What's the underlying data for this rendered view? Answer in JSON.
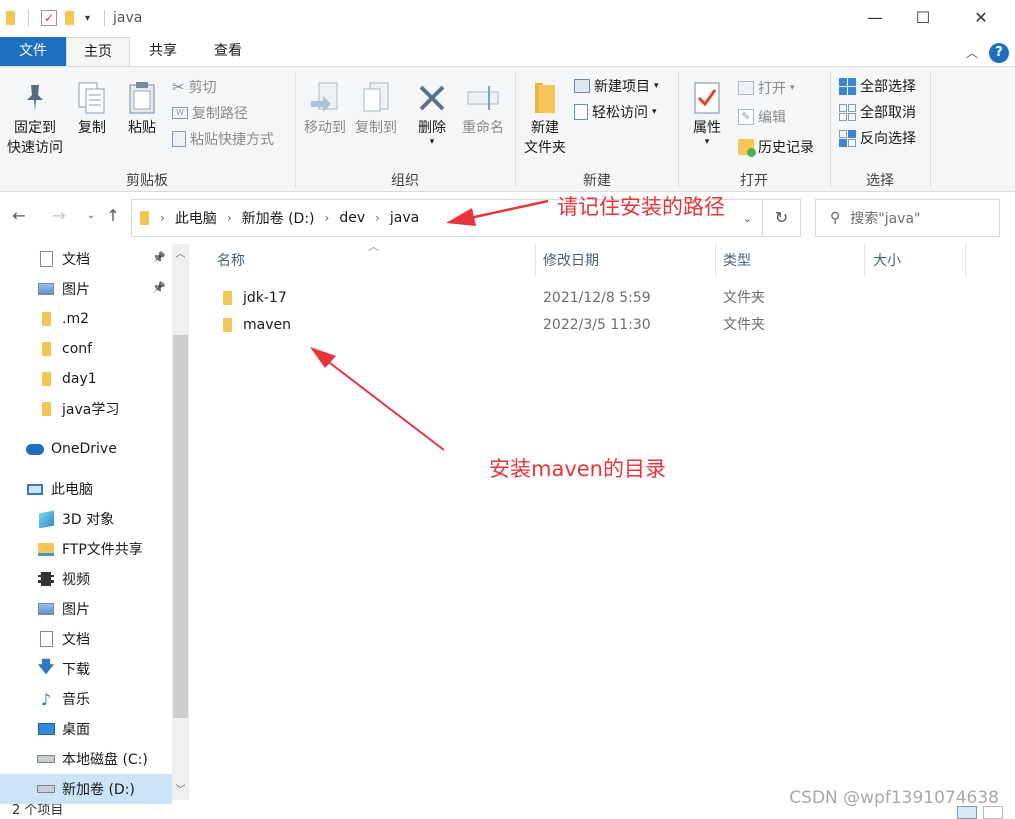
{
  "window": {
    "title": "java",
    "minimize": "—",
    "maximize": "☐",
    "close": "✕"
  },
  "ribbon_tabs": [
    "文件",
    "主页",
    "共享",
    "查看"
  ],
  "ribbon": {
    "clipboard": {
      "label": "剪贴板",
      "pin": "固定到\n快速访问",
      "pin_line1": "固定到",
      "pin_line2": "快速访问",
      "copy": "复制",
      "paste": "粘贴",
      "cut": "剪切",
      "copy_path": "复制路径",
      "paste_shortcut": "粘贴快捷方式"
    },
    "organize": {
      "label": "组织",
      "move_to": "移动到",
      "copy_to": "复制到",
      "delete": "删除",
      "rename": "重命名"
    },
    "new": {
      "label": "新建",
      "new_folder_line1": "新建",
      "new_folder_line2": "文件夹",
      "new_item": "新建项目",
      "easy_access": "轻松访问"
    },
    "open": {
      "label": "打开",
      "properties": "属性",
      "open": "打开",
      "edit": "编辑",
      "history": "历史记录"
    },
    "select": {
      "label": "选择",
      "select_all": "全部选择",
      "select_none": "全部取消",
      "invert": "反向选择"
    }
  },
  "address": {
    "crumbs": [
      "此电脑",
      "新加卷 (D:)",
      "dev",
      "java"
    ],
    "search_placeholder": "搜索\"java\""
  },
  "nav": [
    {
      "label": "文档",
      "icon": "document-icon",
      "pinned": true
    },
    {
      "label": "图片",
      "icon": "pictures-icon",
      "pinned": true
    },
    {
      "label": ".m2",
      "icon": "folder-icon"
    },
    {
      "label": "conf",
      "icon": "folder-icon"
    },
    {
      "label": "day1",
      "icon": "folder-icon"
    },
    {
      "label": "java学习",
      "icon": "folder-icon"
    },
    {
      "label": "OneDrive",
      "icon": "cloud-icon"
    },
    {
      "label": "此电脑",
      "icon": "computer-icon"
    },
    {
      "label": "3D 对象",
      "icon": "3d-objects-icon"
    },
    {
      "label": "FTP文件共享",
      "icon": "ftp-share-icon"
    },
    {
      "label": "视频",
      "icon": "video-icon"
    },
    {
      "label": "图片",
      "icon": "pictures-icon"
    },
    {
      "label": "文档",
      "icon": "document-icon"
    },
    {
      "label": "下载",
      "icon": "download-icon"
    },
    {
      "label": "音乐",
      "icon": "music-icon"
    },
    {
      "label": "桌面",
      "icon": "desktop-icon"
    },
    {
      "label": "本地磁盘 (C:)",
      "icon": "drive-icon"
    },
    {
      "label": "新加卷 (D:)",
      "icon": "drive-icon",
      "selected": true
    }
  ],
  "columns": [
    "名称",
    "修改日期",
    "类型",
    "大小"
  ],
  "files": [
    {
      "name": "jdk-17",
      "date": "2021/12/8 5:59",
      "type": "文件夹",
      "size": ""
    },
    {
      "name": "maven",
      "date": "2022/3/5 11:30",
      "type": "文件夹",
      "size": ""
    }
  ],
  "status": "2 个项目",
  "annotations": {
    "remember_path": "请记住安装的路径",
    "maven_dir": "安装maven的目录"
  },
  "watermark": "CSDN @wpf1391074638",
  "colors": {
    "accent": "#1e6fc2",
    "annotation": "#e8343a",
    "folder": "#f3c655"
  }
}
